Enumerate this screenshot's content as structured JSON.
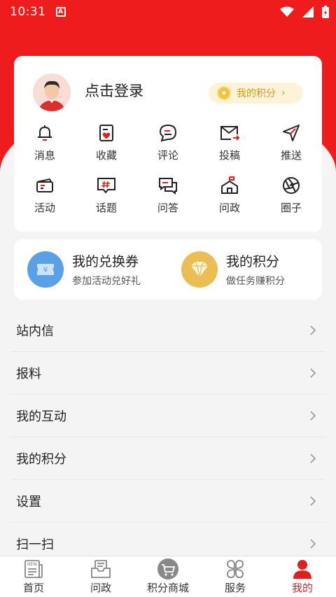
{
  "status_bar": {
    "time": "10:31",
    "notification_badge": "A"
  },
  "profile": {
    "login_label": "点击登录",
    "points_pill_label": "我的积分"
  },
  "quick_grid": [
    {
      "label": "消息",
      "icon": "bell-icon"
    },
    {
      "label": "收藏",
      "icon": "favorite-icon"
    },
    {
      "label": "评论",
      "icon": "comment-icon"
    },
    {
      "label": "投稿",
      "icon": "mail-send-icon"
    },
    {
      "label": "推送",
      "icon": "send-icon"
    },
    {
      "label": "活动",
      "icon": "ticket-icon"
    },
    {
      "label": "话题",
      "icon": "hashtag-icon"
    },
    {
      "label": "问答",
      "icon": "qa-icon"
    },
    {
      "label": "问政",
      "icon": "government-icon"
    },
    {
      "label": "圈子",
      "icon": "aperture-icon"
    }
  ],
  "vouchers": [
    {
      "title": "我的兑换券",
      "subtitle": "参加活动兑好礼",
      "icon": "yen-ticket-icon",
      "color": "#5aa0e6"
    },
    {
      "title": "我的积分",
      "subtitle": "做任务赚积分",
      "icon": "diamond-icon",
      "color": "#ebbe55"
    }
  ],
  "menu": [
    {
      "label": "站内信"
    },
    {
      "label": "报料"
    },
    {
      "label": "我的互动"
    },
    {
      "label": "我的积分"
    },
    {
      "label": "设置"
    },
    {
      "label": "扫一扫"
    }
  ],
  "tabs": [
    {
      "label": "首页",
      "icon": "news-icon",
      "active": false
    },
    {
      "label": "问政",
      "icon": "inbox-icon",
      "active": false
    },
    {
      "label": "积分商城",
      "icon": "cart-icon",
      "active": false
    },
    {
      "label": "服务",
      "icon": "clover-icon",
      "active": false
    },
    {
      "label": "我的",
      "icon": "person-icon",
      "active": true
    }
  ],
  "colors": {
    "brand_red": "#ee1c1c",
    "active_tab": "#e02020",
    "points_gold": "#d49b1a"
  }
}
